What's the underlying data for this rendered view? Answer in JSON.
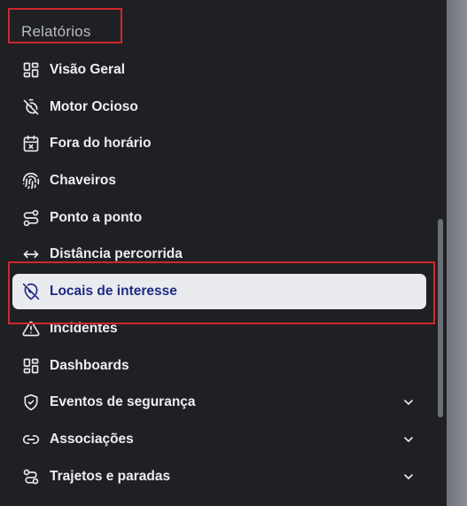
{
  "section": {
    "title": "Relatórios"
  },
  "menu": {
    "items": [
      {
        "label": "Visão Geral",
        "icon": "grid-icon"
      },
      {
        "label": "Motor Ocioso",
        "icon": "stopwatch-off-icon"
      },
      {
        "label": "Fora do horário",
        "icon": "calendar-x-icon"
      },
      {
        "label": "Chaveiros",
        "icon": "fingerprint-icon"
      },
      {
        "label": "Ponto a ponto",
        "icon": "route-icon"
      },
      {
        "label": "Distância percorrida",
        "icon": "arrows-horizontal-icon"
      },
      {
        "label": "Locais de interesse",
        "icon": "map-pin-off-icon",
        "active": true
      },
      {
        "label": "Incidentes",
        "icon": "warning-triangle-icon"
      },
      {
        "label": "Dashboards",
        "icon": "dashboard-grid-icon"
      },
      {
        "label": "Eventos de segurança",
        "icon": "shield-check-icon",
        "expandable": true
      },
      {
        "label": "Associações",
        "icon": "link-icon",
        "expandable": true
      },
      {
        "label": "Trajetos e paradas",
        "icon": "path-icon",
        "expandable": true
      }
    ]
  },
  "colors": {
    "background": "#1f2023",
    "active_bg": "#eaebee",
    "active_text": "#1f2a83",
    "highlight_border": "#d0272b"
  }
}
